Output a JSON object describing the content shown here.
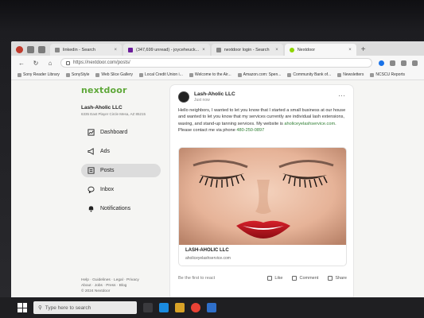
{
  "browser": {
    "tabs": [
      {
        "label": "linkedin - Search",
        "favicon": "search-favicon",
        "active": false
      },
      {
        "label": "(347,699 unread) - joyceheuck...",
        "favicon": "mail-favicon",
        "active": false
      },
      {
        "label": "nextdoor login - Search",
        "favicon": "search-favicon",
        "active": false
      },
      {
        "label": "Nextdoor",
        "favicon": "nextdoor-favicon",
        "active": true
      }
    ],
    "new_tab_glyph": "+",
    "url": "https://nextdoor.com/posts/",
    "bookmarks": [
      "Sony Reader Library",
      "SonyStyle",
      "Web Slice Gallery",
      "Local Credit Union i...",
      "Welcome to the Air...",
      "Amazon.com: Spen...",
      "Community Bank of...",
      "Newsletters",
      "NCSCU Reports"
    ]
  },
  "sidebar": {
    "logo": "nextdoor",
    "business_name": "Lash-Aholic LLC",
    "business_address": "6335 East Player Circle Mesa, AZ 85215",
    "items": [
      {
        "label": "Dashboard",
        "icon": "dashboard-icon",
        "active": false
      },
      {
        "label": "Ads",
        "icon": "megaphone-icon",
        "active": false
      },
      {
        "label": "Posts",
        "icon": "posts-icon",
        "active": true
      },
      {
        "label": "Inbox",
        "icon": "chat-bubble-icon",
        "active": false
      },
      {
        "label": "Notifications",
        "icon": "bell-icon",
        "active": false
      }
    ],
    "footer_line1": "Help · Guidelines · Legal · Privacy",
    "footer_line2": "About · Jobs · Press · Blog",
    "footer_line3": "© 2024 Nextdoor"
  },
  "post": {
    "author": "Lash-Aholic LLC",
    "time": "Just now",
    "more_glyph": "···",
    "body_text": "Hello neighbors, I wanted to let you know that I started a small business at our house and wanted to let you know that my services currently are individual lash extensions, waxing, and stand-up tanning services. My website is ",
    "body_link": "aholiceyelashservice.com",
    "body_text2": ". Please contact me via phone ",
    "body_phone": "480-250-0897",
    "link_title": "LASH-AHOLIC LLC",
    "link_url": "aholiceyelashservice.com",
    "reactions_prompt": "Be the first to react",
    "like_label": "Like",
    "comment_label": "Comment",
    "share_label": "Share"
  },
  "taskbar": {
    "search_placeholder": "Type here to search"
  },
  "colors": {
    "brand_green": "#5fa83a",
    "link_green": "#2e7d32",
    "active_nav_bg": "#dcdcdc"
  }
}
